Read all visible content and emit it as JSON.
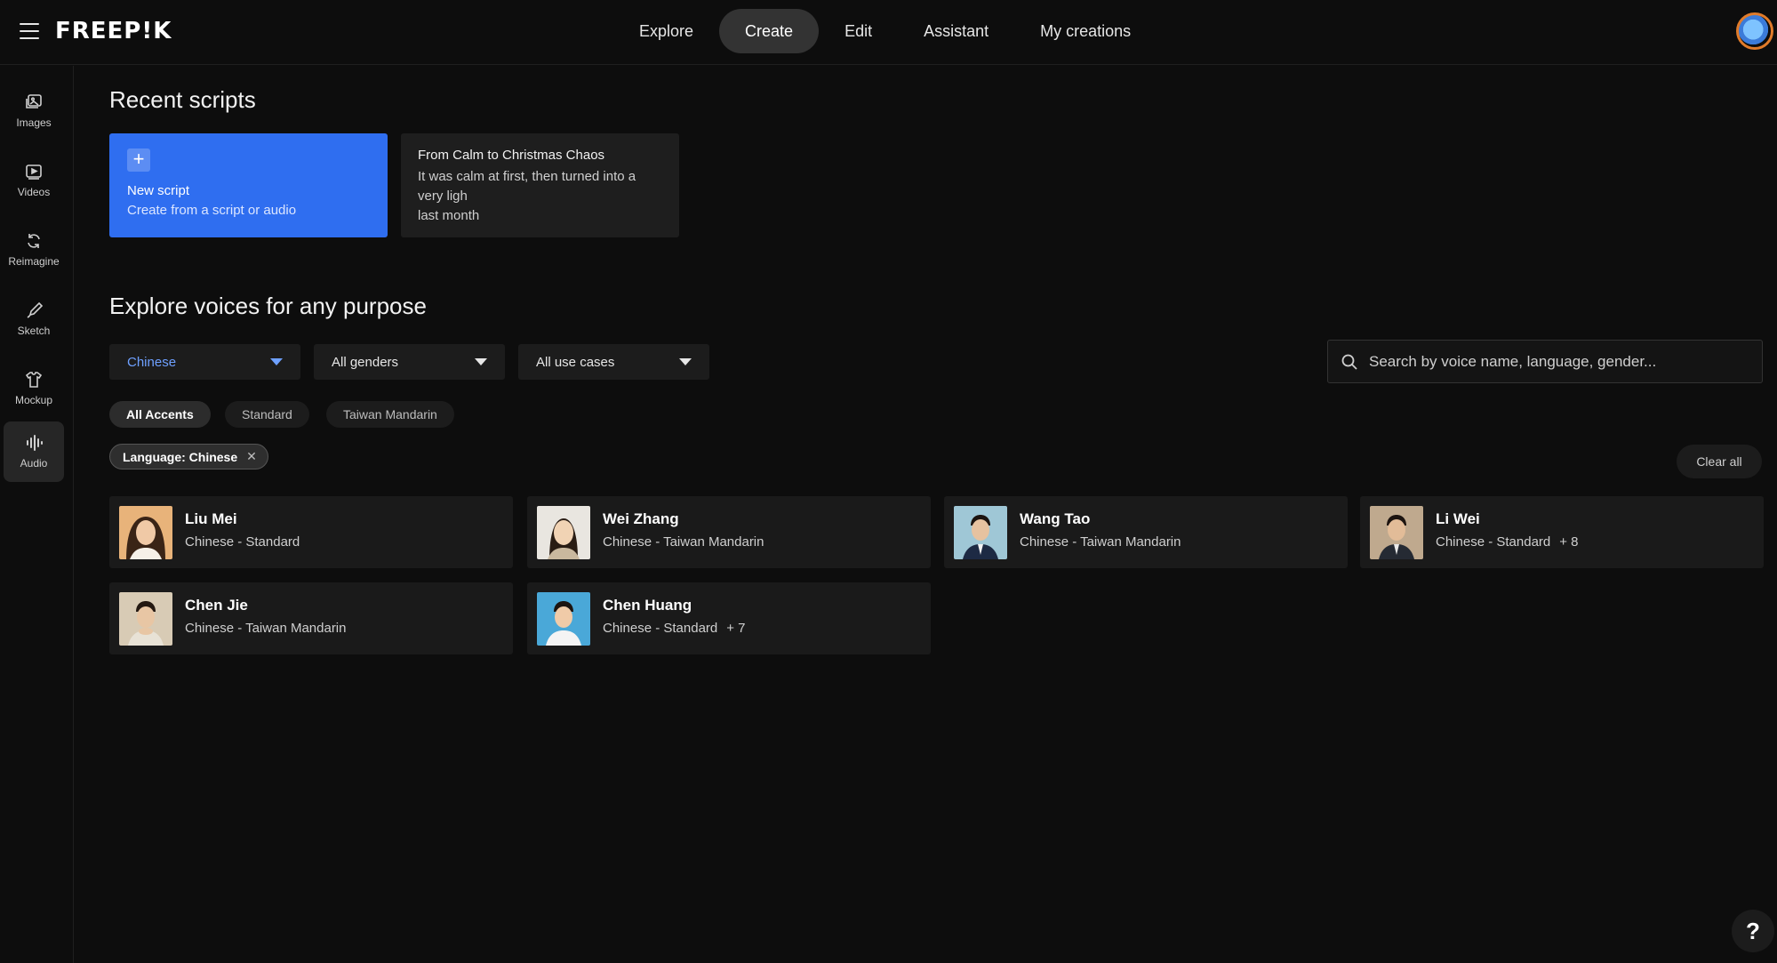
{
  "app": {
    "logo": "FREEP!K"
  },
  "nav": {
    "tabs": [
      {
        "label": "Explore"
      },
      {
        "label": "Create"
      },
      {
        "label": "Edit"
      },
      {
        "label": "Assistant"
      },
      {
        "label": "My creations"
      }
    ],
    "active": "Create"
  },
  "sidebar": {
    "items": [
      {
        "label": "Images",
        "icon": "images-icon"
      },
      {
        "label": "Videos",
        "icon": "videos-icon"
      },
      {
        "label": "Reimagine",
        "icon": "reimagine-icon"
      },
      {
        "label": "Sketch",
        "icon": "sketch-icon"
      },
      {
        "label": "Mockup",
        "icon": "mockup-icon"
      },
      {
        "label": "Audio",
        "icon": "audio-icon"
      }
    ],
    "active": "Audio"
  },
  "recent": {
    "title": "Recent scripts",
    "new_script": {
      "title": "New script",
      "subtitle": "Create from a script or audio"
    },
    "scripts": [
      {
        "title": "From Calm to Christmas Chaos",
        "body": "It was calm at first, then turned into a very ligh",
        "time": "last month"
      }
    ]
  },
  "explore": {
    "title": "Explore voices for any purpose",
    "filters": {
      "language": "Chinese",
      "gender": "All genders",
      "use_case": "All use cases"
    },
    "search": {
      "placeholder": "Search by voice name, language, gender..."
    },
    "accents": [
      "All Accents",
      "Standard",
      "Taiwan Mandarin"
    ],
    "active_tag": "Language: Chinese",
    "clear_all": "Clear all",
    "voices": [
      {
        "name": "Liu Mei",
        "desc": "Chinese - Standard",
        "more": ""
      },
      {
        "name": "Wei Zhang",
        "desc": "Chinese - Taiwan Mandarin",
        "more": ""
      },
      {
        "name": "Wang Tao",
        "desc": "Chinese - Taiwan Mandarin",
        "more": ""
      },
      {
        "name": "Li Wei",
        "desc": "Chinese - Standard",
        "more": "+ 8"
      },
      {
        "name": "Chen Jie",
        "desc": "Chinese - Taiwan Mandarin",
        "more": ""
      },
      {
        "name": "Chen Huang",
        "desc": "Chinese - Standard",
        "more": "+ 7"
      }
    ]
  },
  "help": {
    "label": "?"
  },
  "colors": {
    "accent": "#2f6ef0",
    "link": "#6ea0ff",
    "background": "#0d0d0d"
  }
}
